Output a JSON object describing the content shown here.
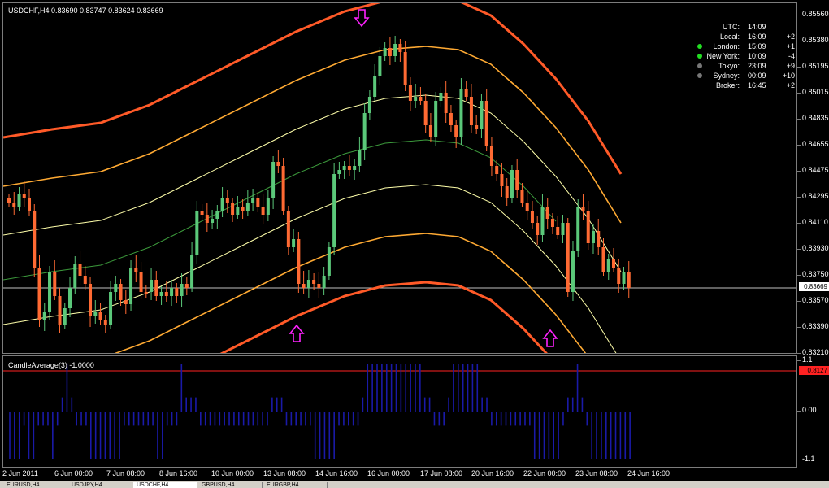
{
  "main_chart": {
    "title": "USDCHF,H4  0.83690 0.83747 0.83624 0.83669",
    "current_price": "0.83669",
    "price_ticks": [
      "0.85560",
      "0.85380",
      "0.85195",
      "0.85015",
      "0.84835",
      "0.84655",
      "0.84475",
      "0.84295",
      "0.84110",
      "0.83930",
      "0.83750",
      "0.83570",
      "0.83390",
      "0.83210"
    ],
    "colors": {
      "background": "#000000",
      "bull": "#5bc87a",
      "bear": "#ff6a33",
      "mid_band": "#3c9a3c",
      "inner_band": "#ffffaa",
      "outer_band": "#ffaa33",
      "extreme_band": "#ff5a28",
      "arrow": "#ff22ff",
      "current_line": "#c0c0c0"
    },
    "arrows": [
      {
        "direction": "down",
        "label": "sell-arrow"
      },
      {
        "direction": "up",
        "label": "buy-arrow"
      },
      {
        "direction": "up",
        "label": "buy-arrow"
      }
    ]
  },
  "clock": {
    "rows": [
      {
        "name": "UTC:",
        "time": "14:09",
        "offset": "",
        "dot": ""
      },
      {
        "name": "Local:",
        "time": "16:09",
        "offset": "+2",
        "dot": ""
      },
      {
        "name": "London:",
        "time": "15:09",
        "offset": "+1",
        "dot": "#22dd22"
      },
      {
        "name": "New York:",
        "time": "10:09",
        "offset": "-4",
        "dot": "#22dd22"
      },
      {
        "name": "Tokyo:",
        "time": "23:09",
        "offset": "+9",
        "dot": "#777777"
      },
      {
        "name": "Sydney:",
        "time": "00:09",
        "offset": "+10",
        "dot": "#777777"
      },
      {
        "name": "Broker:",
        "time": "16:45",
        "offset": "+2",
        "dot": ""
      }
    ]
  },
  "sub_chart": {
    "title": "CandleAverage(3) -1.0000",
    "ticks": [
      "1.1",
      "0.00",
      "-1.1"
    ],
    "current_value": "0.8127",
    "colors": {
      "bars": "#1a1aa8",
      "signal_line": "#ff2222"
    }
  },
  "time_axis": {
    "labels": [
      "2 Jun 2011",
      "6 Jun 00:00",
      "7 Jun 08:00",
      "8 Jun 16:00",
      "10 Jun 00:00",
      "13 Jun 08:00",
      "14 Jun 16:00",
      "16 Jun 00:00",
      "17 Jun 08:00",
      "20 Jun 16:00",
      "22 Jun 00:00",
      "23 Jun 08:00",
      "24 Jun 16:00"
    ]
  },
  "tabs": [
    {
      "label": "EURUSD,H4"
    },
    {
      "label": "USDJPY,H4"
    },
    {
      "label": "USDCHF,H4"
    },
    {
      "label": "GBPUSD,H4"
    },
    {
      "label": "EURGBP,H4"
    }
  ]
}
